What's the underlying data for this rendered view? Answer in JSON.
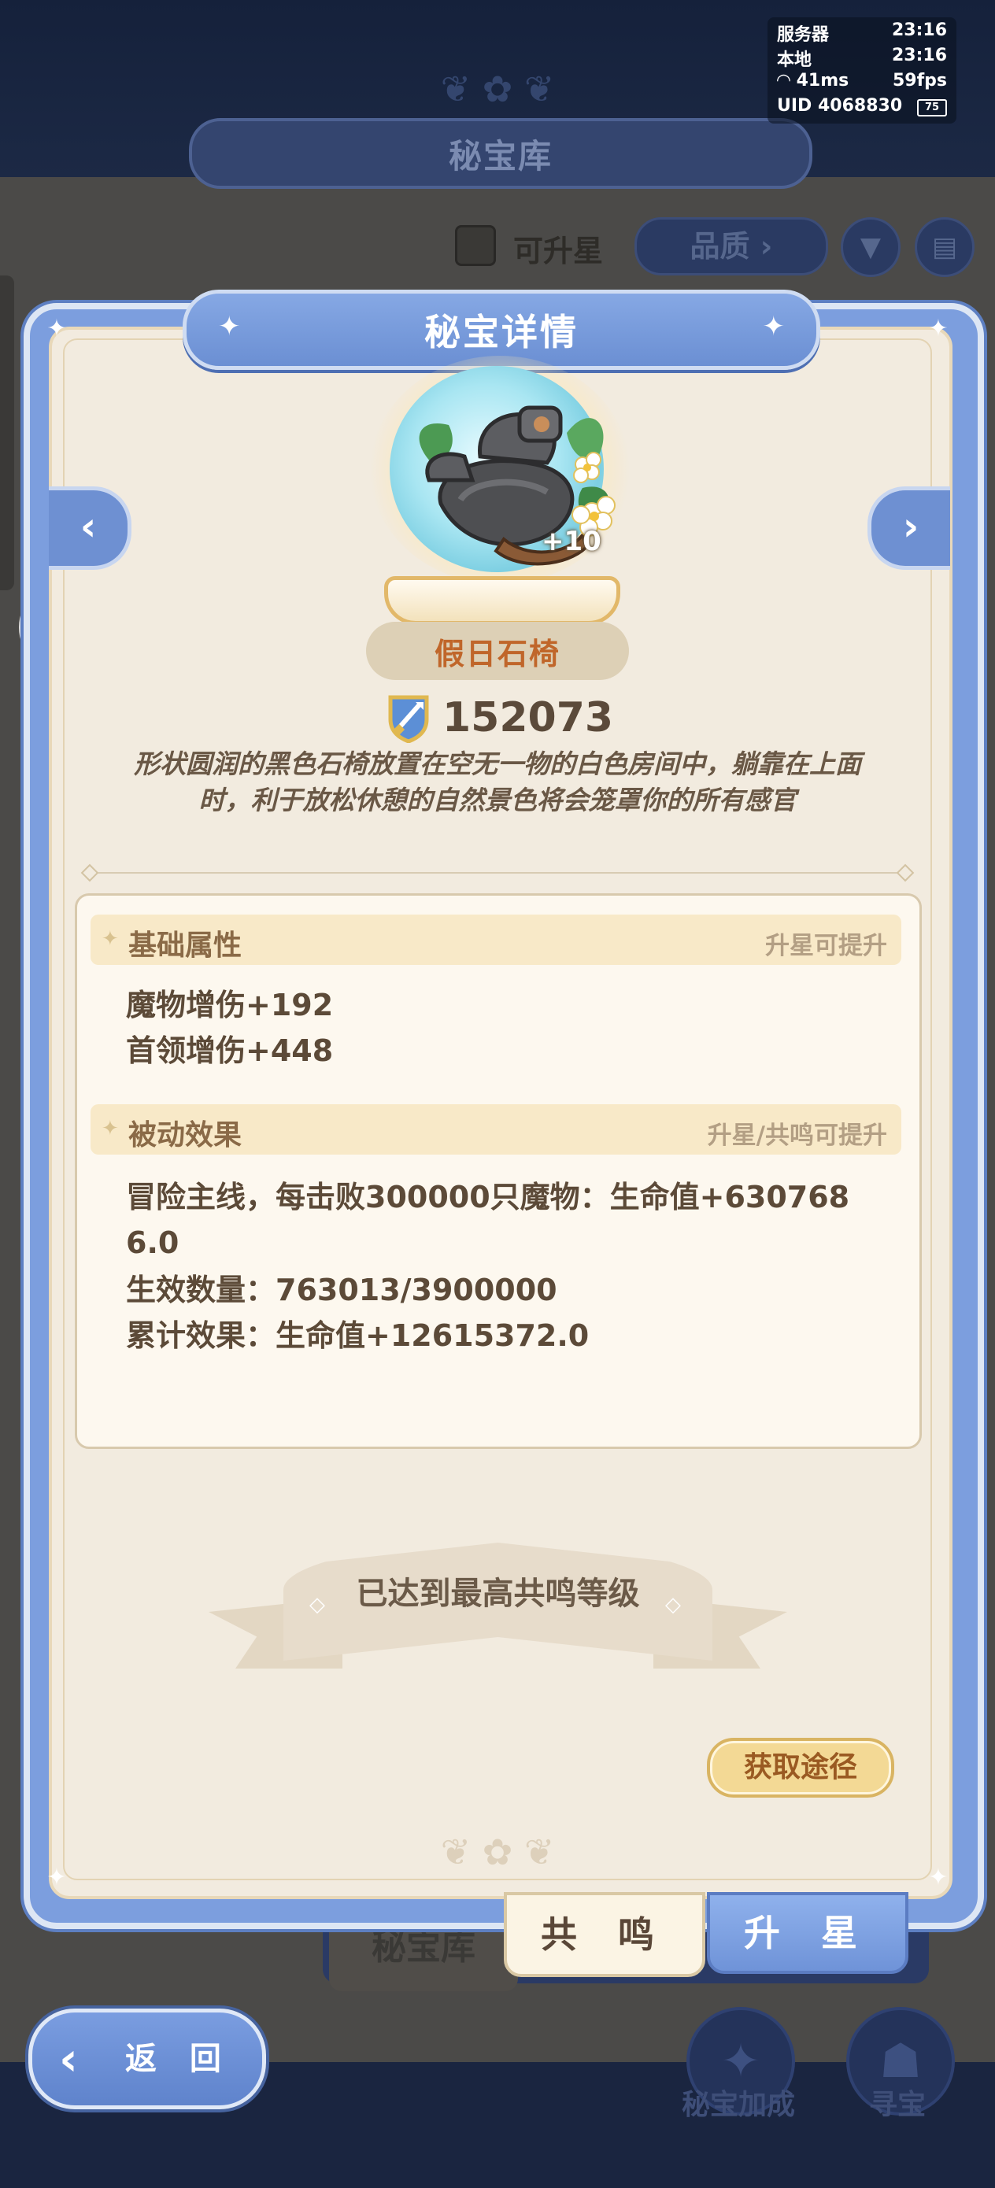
{
  "status": {
    "server_label": "服务器",
    "server_time": "23:16",
    "local_label": "本地",
    "local_time": "23:16",
    "ping": "41ms",
    "fps": "59fps",
    "uid": "UID 4068830",
    "battery": "75"
  },
  "background": {
    "library_title": "秘宝库",
    "can_upgrade_label": "可升星",
    "quality_filter": "品质",
    "tab_library": "秘宝库",
    "bonus_label": "秘宝加成",
    "treasure_hunt_label": "寻宝"
  },
  "detail": {
    "title": "秘宝详情",
    "item_level": "+10",
    "item_name": "假日石椅",
    "score": "152073",
    "description": "形状圆润的黑色石椅放置在空无一物的白色房间中，躺靠在上面时，利于放松休憩的自然景色将会笼罩你的所有感官",
    "basic": {
      "title": "基础属性",
      "hint": "升星可提升",
      "lines": [
        "魔物增伤+192",
        "首领增伤+448"
      ]
    },
    "passive": {
      "title": "被动效果",
      "hint": "升星/共鸣可提升",
      "lines": [
        "冒险主线，每击败300000只魔物：生命值+630768",
        "6.0",
        "生效数量：763013/3900000",
        "累计效果：生命值+12615372.0"
      ]
    },
    "max_resonance": "已达到最高共鸣等级",
    "acquire_button": "获取途径"
  },
  "tabs": {
    "resonance": "共 鸣",
    "star_up": "升 星"
  },
  "back_button": "返 回",
  "colors": {
    "panel_blue": "#7c9ede",
    "panel_bg": "#f2ebdf",
    "accent_orange": "#c0662a"
  },
  "icons": [
    "chat-bubble-icon",
    "prev-arrow-icon",
    "next-arrow-icon",
    "shield-sword-icon",
    "back-arrow-icon",
    "filter-icon",
    "book-icon"
  ]
}
